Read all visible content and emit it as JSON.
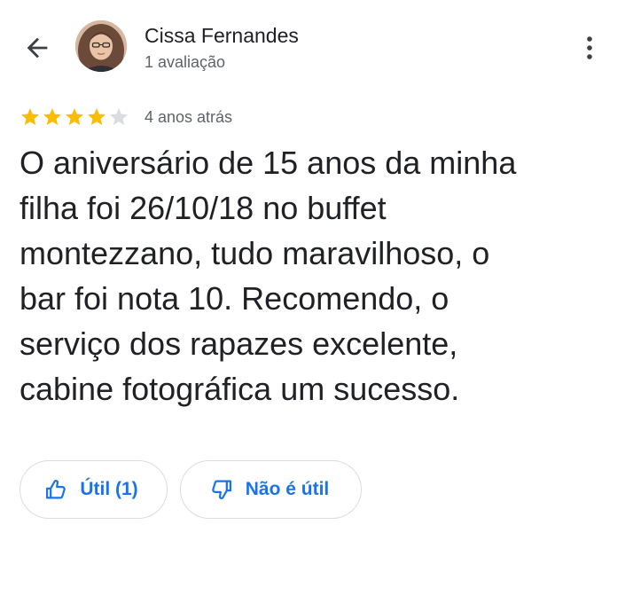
{
  "header": {
    "back_icon": "arrow-back-icon",
    "user_name": "Cissa Fernandes",
    "review_count": "1 avaliação",
    "more_icon": "more-vert-icon"
  },
  "review": {
    "rating": 4,
    "max_rating": 5,
    "star_color_filled": "#fbbc04",
    "star_color_empty": "#dadce0",
    "time_ago": "4 anos atrás",
    "lines": [
      "O aniversário de 15 anos da minha",
      "filha foi 26/10/18 no buffet",
      "montezzano, tudo maravilhoso, o",
      "bar foi nota 10. Recomendo, o",
      "serviço dos rapazes excelente,",
      "cabine fotográfica um sucesso."
    ]
  },
  "actions": {
    "useful_label": "Útil (1)",
    "useful_icon": "thumb-up-icon",
    "not_useful_label": "Não é útil",
    "not_useful_icon": "thumb-down-icon",
    "accent_color": "#1a73e8"
  }
}
